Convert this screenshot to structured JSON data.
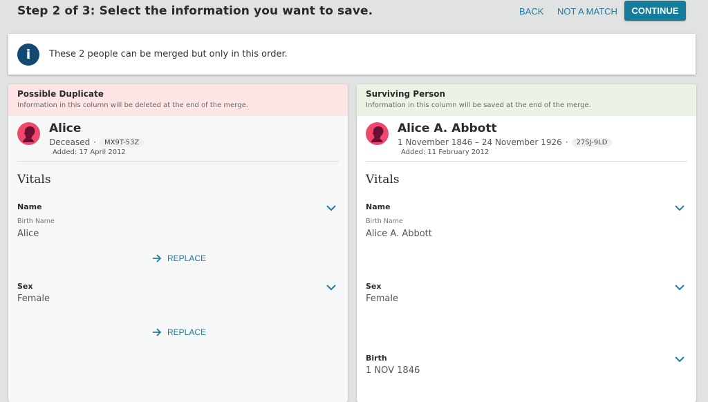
{
  "header": {
    "step_title": "Step 2 of 3: Select the information you want to save.",
    "back_label": "BACK",
    "not_a_match_label": "NOT A MATCH",
    "continue_label": "CONTINUE"
  },
  "banner": {
    "icon": "info-icon",
    "icon_glyph": "i",
    "text": "These 2 people can be merged but only in this order."
  },
  "colors": {
    "accent": "#167c9b",
    "link": "#217aa2",
    "info_icon": "#124a74",
    "duplicate_header_bg": "#fde5e5",
    "surviving_header_bg": "#ebf3e6",
    "avatar_bg": "#f0486c",
    "avatar_silhouette": "#6b0f35"
  },
  "duplicate": {
    "header_title": "Possible Duplicate",
    "header_subtitle": "Information in this column will be deleted at the end of the merge.",
    "name": "Alice",
    "lifespan": "Deceased",
    "separator": "·",
    "pid": "MX9T-53Z",
    "added": "Added: 17 April 2012",
    "section_title": "Vitals",
    "fields": [
      {
        "label": "Name",
        "sublabel": "Birth Name",
        "value": "Alice",
        "action": "REPLACE"
      },
      {
        "label": "Sex",
        "value": "Female",
        "action": "REPLACE"
      }
    ]
  },
  "surviving": {
    "header_title": "Surviving Person",
    "header_subtitle": "Information in this column will be saved at the end of the merge.",
    "name": "Alice A. Abbott",
    "lifespan": "1 November 1846 – 24 November 1926",
    "separator": "·",
    "pid": "27SJ-9LD",
    "added": "Added: 11 February 2012",
    "section_title": "Vitals",
    "fields": [
      {
        "label": "Name",
        "sublabel": "Birth Name",
        "value": "Alice A. Abbott"
      },
      {
        "label": "Sex",
        "value": "Female"
      },
      {
        "label": "Birth",
        "value": "1 NOV 1846"
      }
    ]
  }
}
